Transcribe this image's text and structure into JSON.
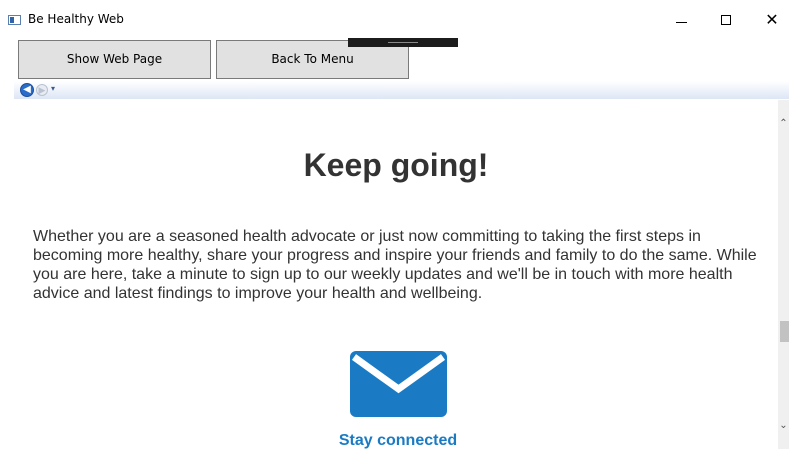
{
  "window": {
    "title": "Be Healthy Web",
    "icon": "app-window-icon",
    "minimize_icon": "minimize-icon",
    "maximize_icon": "maximize-icon",
    "close_glyph": "✕"
  },
  "toolbar": {
    "show_web_page_label": "Show Web Page",
    "back_to_menu_label": "Back To Menu"
  },
  "navbar": {
    "back_glyph": "◀",
    "forward_glyph": "▶",
    "dropdown_glyph": "▾"
  },
  "page": {
    "heading": "Keep going!",
    "paragraph": "Whether you are a seasoned health advocate or just now committing to taking the first steps in becoming more healthy, share your progress and inspire your friends and family to do the same. While you are here, take a minute to sign up to our weekly updates and we'll be in touch with more health advice and latest findings to improve your health and wellbeing.",
    "mail_icon": "envelope-icon",
    "stay_connected": "Stay connected"
  },
  "scrollbar": {
    "up_glyph": "⌃",
    "down_glyph": "⌄"
  },
  "colors": {
    "link_blue": "#1a7bc4",
    "envelope_blue": "#1a7bc4",
    "text_dark": "#333333"
  }
}
